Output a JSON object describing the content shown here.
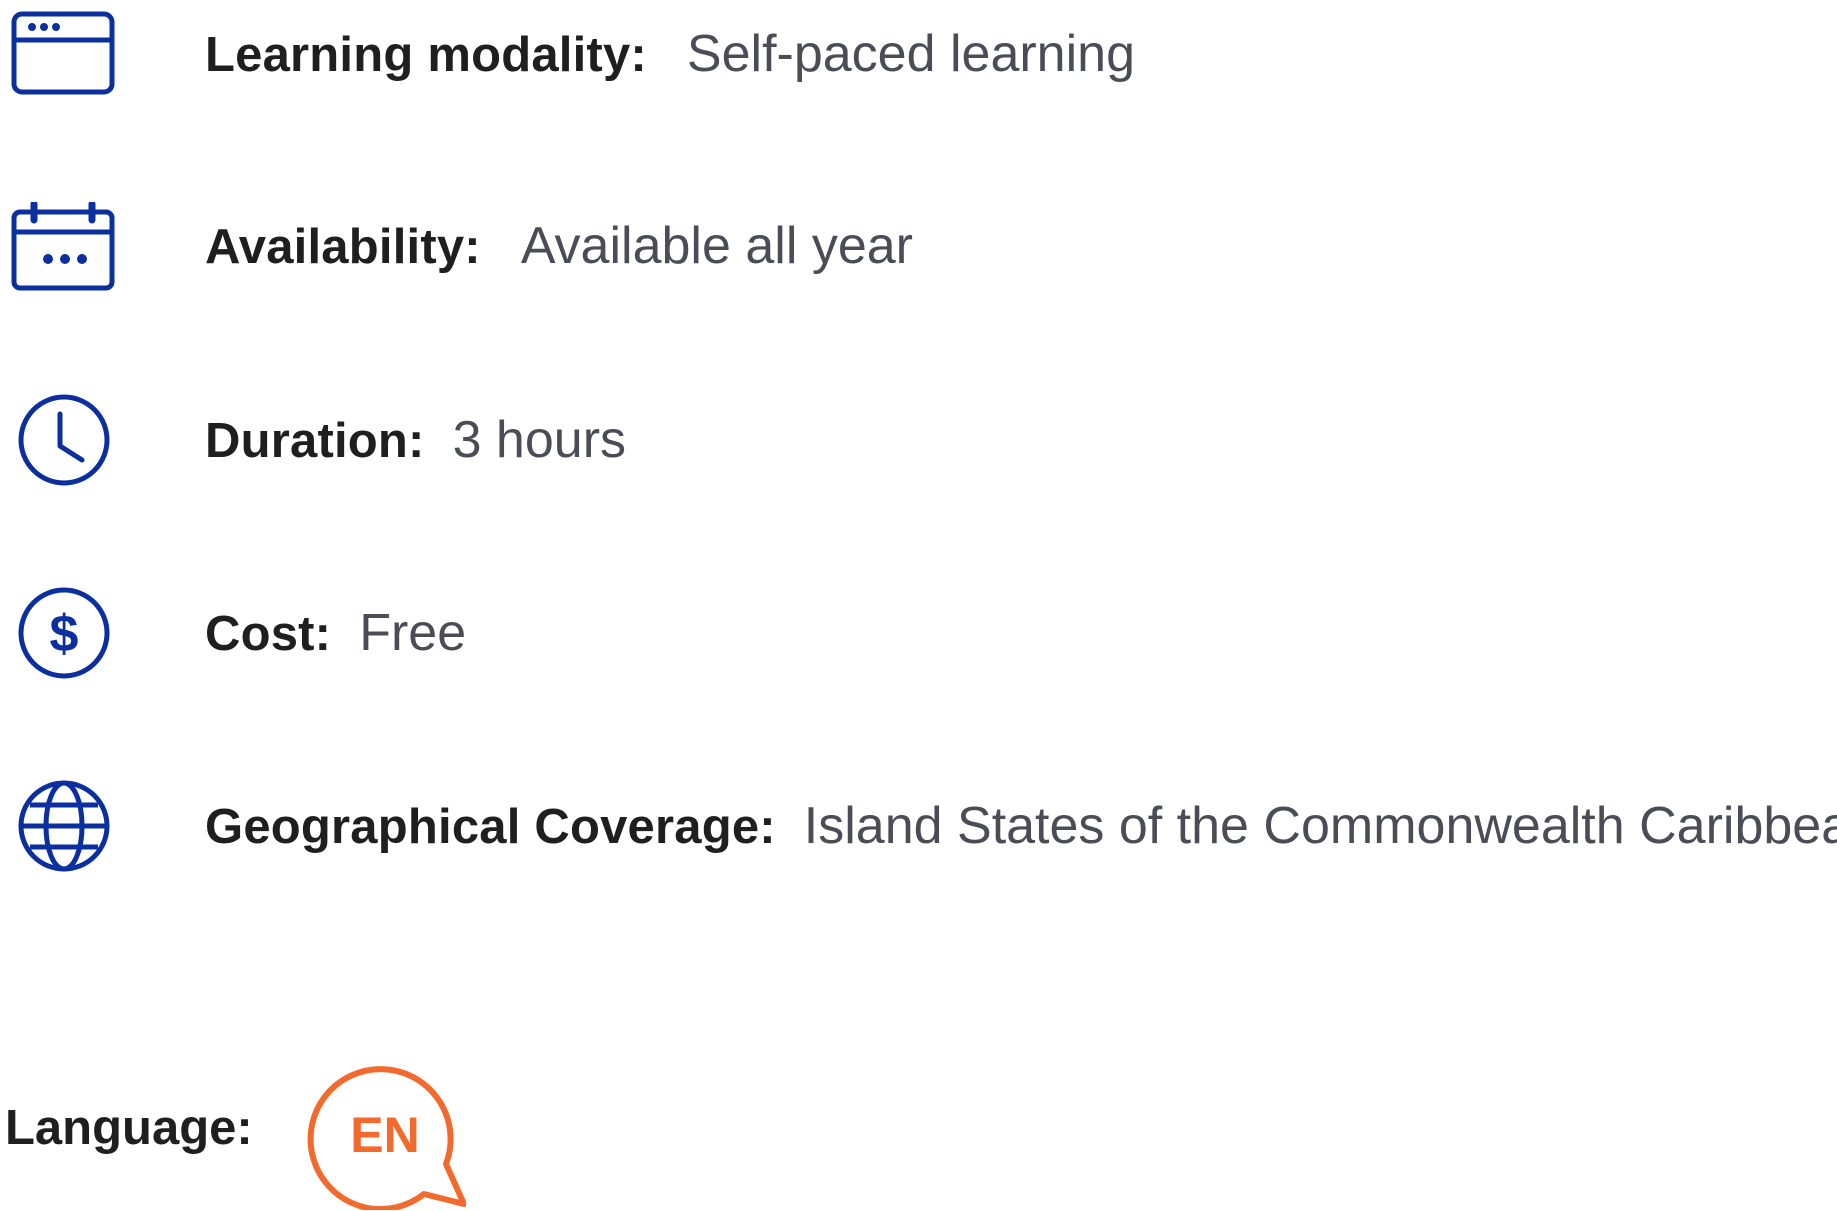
{
  "colors": {
    "icon_blue": "#0b2f9f",
    "label_text": "#1f1f1f",
    "value_text": "#4a4d55",
    "language_orange": "#f26a2e"
  },
  "details": [
    {
      "icon": "browser-window-icon",
      "label": "Learning modality:",
      "value": "Self-paced learning"
    },
    {
      "icon": "calendar-icon",
      "label": "Availability:",
      "value": "Available all year"
    },
    {
      "icon": "clock-icon",
      "label": "Duration:",
      "value": "3 hours"
    },
    {
      "icon": "dollar-icon",
      "label": "Cost:",
      "value": "Free"
    },
    {
      "icon": "globe-icon",
      "label": "Geographical Coverage:",
      "value": "Island States of the Commonwealth Caribbean"
    }
  ],
  "language": {
    "label": "Language:",
    "code": "EN",
    "icon": "speech-bubble-icon"
  }
}
